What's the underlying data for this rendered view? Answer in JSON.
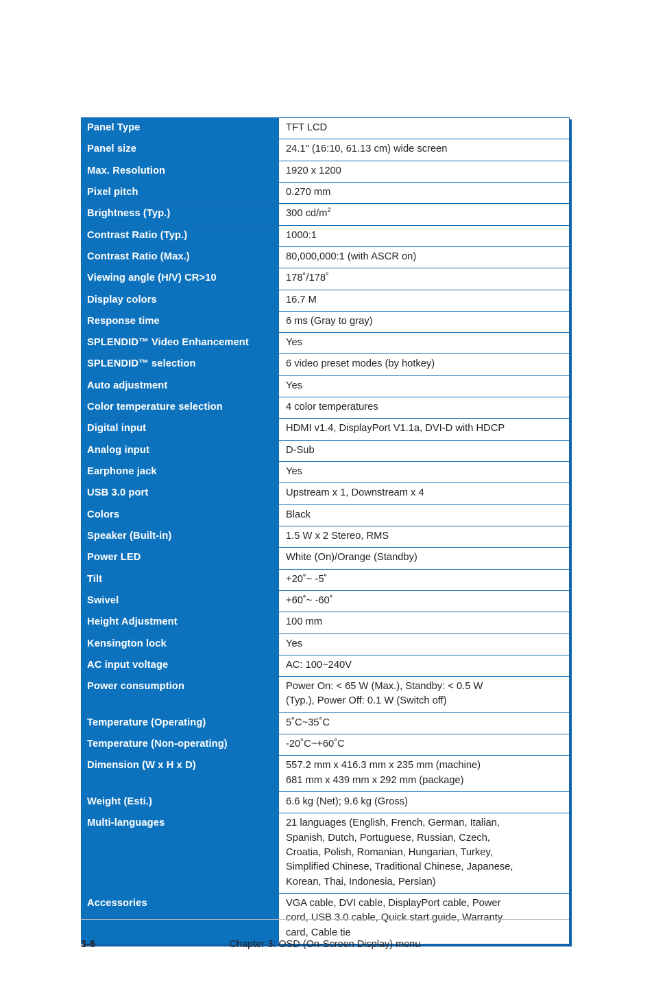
{
  "document": {
    "footer": {
      "page_number": "3-6",
      "chapter_text": "Chapter 3: OSD (On-Screen Display) menu"
    },
    "accent_color": "#0d72bd",
    "border_color": "#0f6cb5"
  },
  "spec_table": {
    "rows": [
      {
        "key": "Panel Type",
        "value": "TFT LCD"
      },
      {
        "key": "Panel size",
        "value": "24.1\" (16:10, 61.13 cm) wide screen"
      },
      {
        "key": "Max. Resolution",
        "value": "1920 x 1200"
      },
      {
        "key": "Pixel pitch",
        "value": "0.270 mm"
      },
      {
        "key": "Brightness (Typ.)",
        "value": "300 cd/m",
        "value_sup": "2"
      },
      {
        "key": "Contrast Ratio (Typ.)",
        "value": "1000:1"
      },
      {
        "key": "Contrast Ratio (Max.)",
        "value": "80,000,000:1 (with ASCR on)"
      },
      {
        "key": "Viewing angle (H/V) CR>10",
        "value": "178˚/178˚"
      },
      {
        "key": "Display colors",
        "value": "16.7 M"
      },
      {
        "key": "Response time",
        "value": "6 ms (Gray to gray)"
      },
      {
        "key": "SPLENDID™ Video Enhancement",
        "value": "Yes"
      },
      {
        "key": "SPLENDID™ selection",
        "value": "6 video preset modes (by hotkey)"
      },
      {
        "key": "Auto adjustment",
        "value": "Yes"
      },
      {
        "key": "Color temperature selection",
        "value": "4 color temperatures"
      },
      {
        "key": "Digital input",
        "value": "HDMI v1.4, DisplayPort V1.1a, DVI-D with HDCP"
      },
      {
        "key": "Analog input",
        "value": "D-Sub"
      },
      {
        "key": "Earphone jack",
        "value": "Yes"
      },
      {
        "key": "USB 3.0 port",
        "value": "Upstream x 1, Downstream x 4"
      },
      {
        "key": "Colors",
        "value": "Black"
      },
      {
        "key": "Speaker (Built-in)",
        "value": "1.5 W x 2 Stereo, RMS"
      },
      {
        "key": "Power LED",
        "value": "White (On)/Orange (Standby)"
      },
      {
        "key": "Tilt",
        "value": "+20˚~ -5˚"
      },
      {
        "key": "Swivel",
        "value": "+60˚~ -60˚"
      },
      {
        "key": "Height Adjustment",
        "value": "100 mm"
      },
      {
        "key": "Kensington lock",
        "value": "Yes"
      },
      {
        "key": "AC input voltage",
        "value": "AC: 100~240V"
      },
      {
        "key": "Power consumption",
        "value": "Power On: < 65 W (Max.), Standby: < 0.5 W\n(Typ.), Power Off: 0.1 W (Switch off)"
      },
      {
        "key": "Temperature (Operating)",
        "value": "5˚C~35˚C"
      },
      {
        "key": "Temperature (Non-operating)",
        "value": "-20˚C~+60˚C"
      },
      {
        "key": "Dimension (W x H x D)",
        "value": "557.2 mm x 416.3 mm x 235 mm (machine)\n681 mm x 439 mm x 292 mm (package)"
      },
      {
        "key": "Weight (Esti.)",
        "value": "6.6 kg (Net); 9.6 kg (Gross)"
      },
      {
        "key": "Multi-languages",
        "value": "21 languages (English, French, German, Italian,\nSpanish, Dutch, Portuguese, Russian, Czech,\nCroatia, Polish, Romanian, Hungarian, Turkey,\nSimplified Chinese, Traditional Chinese, Japanese,\nKorean, Thai, Indonesia, Persian)"
      },
      {
        "key": "Accessories",
        "value": "VGA cable, DVI cable, DisplayPort cable, Power\ncord, USB 3.0 cable, Quick start guide, Warranty\ncard, Cable tie"
      }
    ]
  }
}
